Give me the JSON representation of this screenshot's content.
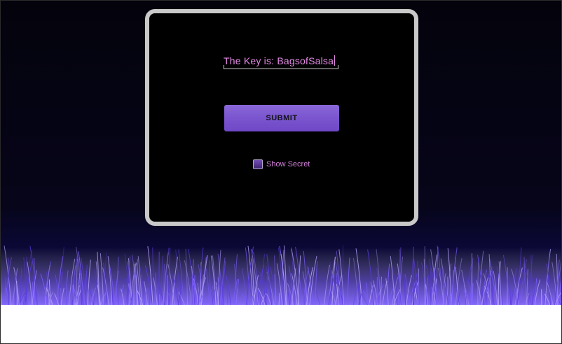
{
  "key_field": {
    "value": "The Key is: BagsofSalsa"
  },
  "submit_button": {
    "label": "SUBMIT"
  },
  "show_secret": {
    "label": "Show Secret",
    "checked": false
  },
  "colors": {
    "background": "#05040d",
    "card": "#000000",
    "card_border": "#c9c9c9",
    "accent_button": "#7a55cf",
    "text_pink": "#e58be6",
    "grass": "#6a3bff"
  }
}
